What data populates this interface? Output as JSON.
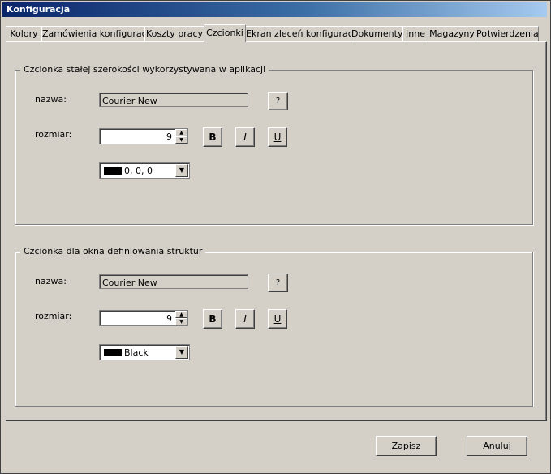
{
  "window": {
    "title": "Konfiguracja"
  },
  "tabs": [
    {
      "label": "Kolory"
    },
    {
      "label": "Zamówienia konfiguracja"
    },
    {
      "label": "Koszty pracy"
    },
    {
      "label": "Czcionki",
      "active": true
    },
    {
      "label": "Ekran zleceń konfiguracja"
    },
    {
      "label": "Dokumenty"
    },
    {
      "label": "Inne"
    },
    {
      "label": "Magazyny"
    },
    {
      "label": "Potwierdzenia"
    }
  ],
  "group1": {
    "legend": "Czcionka stałej szerokości wykorzystywana w aplikacji",
    "name_label": "nazwa:",
    "name_value": "Courier New",
    "browse_label": "?",
    "size_label": "rozmiar:",
    "size_value": "9",
    "bold_label": "B",
    "italic_label": "I",
    "underline_label": "U",
    "color_value": "0, 0, 0",
    "color_swatch": "#000000"
  },
  "group2": {
    "legend": "Czcionka dla okna definiowania struktur",
    "name_label": "nazwa:",
    "name_value": "Courier New",
    "browse_label": "?",
    "size_label": "rozmiar:",
    "size_value": "9",
    "bold_label": "B",
    "italic_label": "I",
    "underline_label": "U",
    "color_value": "Black",
    "color_swatch": "#000000"
  },
  "footer": {
    "save_label": "Zapisz",
    "cancel_label": "Anuluj"
  }
}
